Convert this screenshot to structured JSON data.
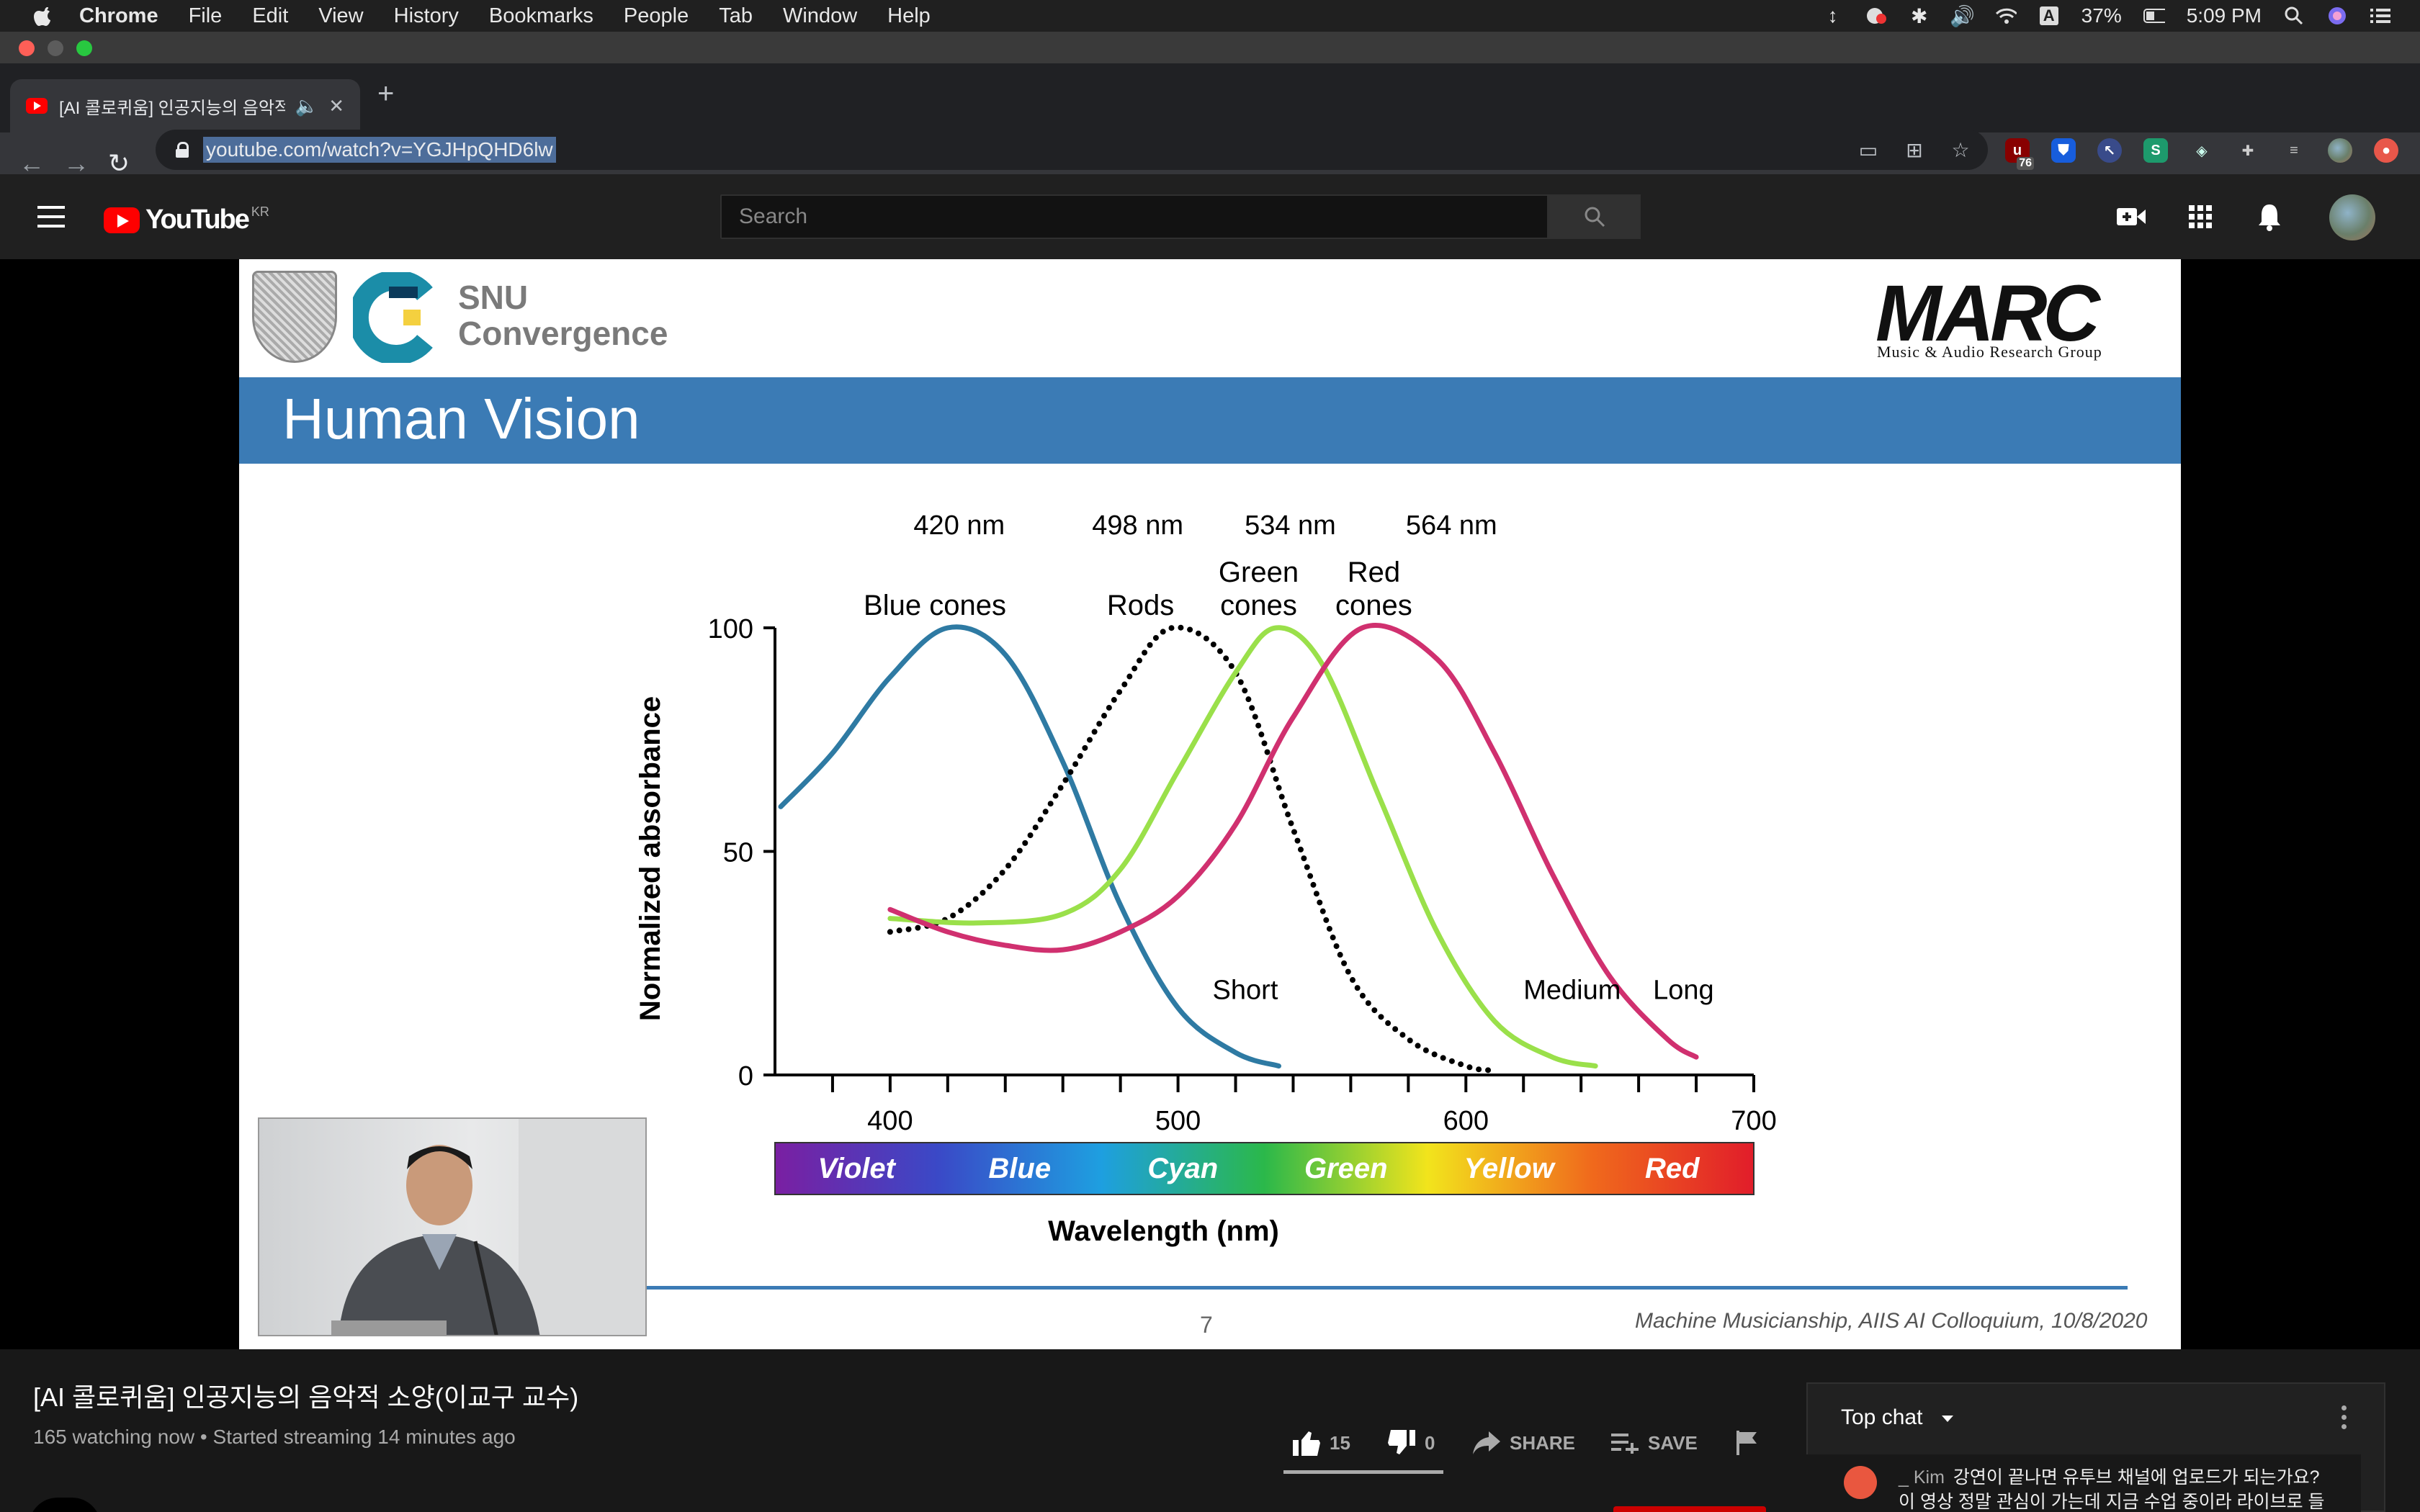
{
  "menubar": {
    "app": "Chrome",
    "items": [
      "File",
      "Edit",
      "View",
      "History",
      "Bookmarks",
      "People",
      "Tab",
      "Window",
      "Help"
    ],
    "battery": "37%",
    "time": "5:09 PM",
    "input_badge": "A"
  },
  "browser": {
    "tab_title": "[AI 콜로퀴움] 인공지능의 음악적",
    "url": "youtube.com/watch?v=YGJHpQHD6lw",
    "ext_badge": "76",
    "ext_s_label": "S"
  },
  "youtube": {
    "logo_text": "YouTube",
    "country": "KR",
    "search_placeholder": "Search"
  },
  "slide": {
    "org_line1": "SNU",
    "org_line2": "Convergence",
    "marc_logo": "MARC",
    "marc_sub": "Music & Audio Research Group",
    "title": "Human Vision",
    "page_number": "7",
    "footer": "Machine Musicianship, AIIS AI Colloquium, 10/8/2020"
  },
  "chart_data": {
    "type": "line",
    "xlabel": "Wavelength (nm)",
    "ylabel": "Normalized absorbance",
    "xlim": [
      360,
      700
    ],
    "ylim": [
      0,
      100
    ],
    "x_ticks": [
      400,
      500,
      600,
      700
    ],
    "y_ticks": [
      0,
      50,
      100
    ],
    "peaks": [
      "420 nm",
      "498 nm",
      "534 nm",
      "564 nm"
    ],
    "series": [
      {
        "name": "Blue cones",
        "end_label": "Short",
        "color": "#2e7aa3",
        "style": "solid",
        "x": [
          362,
          380,
          400,
          420,
          440,
          460,
          480,
          500,
          520,
          535
        ],
        "y": [
          60,
          72,
          89,
          100,
          94,
          70,
          38,
          15,
          5,
          2
        ]
      },
      {
        "name": "Rods",
        "end_label": "",
        "color": "#000000",
        "style": "dotted",
        "x": [
          400,
          420,
          440,
          460,
          480,
          498,
          520,
          540,
          560,
          580,
          600,
          610
        ],
        "y": [
          32,
          35,
          46,
          65,
          86,
          100,
          90,
          55,
          22,
          8,
          2,
          1
        ]
      },
      {
        "name": "Green cones",
        "end_label": "Medium",
        "color": "#9ae04a",
        "style": "solid",
        "x": [
          400,
          430,
          460,
          480,
          500,
          520,
          534,
          550,
          570,
          590,
          610,
          630,
          645
        ],
        "y": [
          35,
          34,
          36,
          46,
          68,
          90,
          100,
          92,
          62,
          32,
          12,
          4,
          2
        ]
      },
      {
        "name": "Red cones",
        "end_label": "Long",
        "color": "#d0306f",
        "style": "solid",
        "x": [
          400,
          420,
          440,
          460,
          480,
          500,
          520,
          540,
          564,
          590,
          610,
          630,
          650,
          670,
          680
        ],
        "y": [
          37,
          32,
          29,
          28,
          32,
          40,
          56,
          80,
          100,
          93,
          72,
          45,
          22,
          8,
          4
        ]
      }
    ],
    "spectrum": {
      "labels": [
        "Violet",
        "Blue",
        "Cyan",
        "Green",
        "Yellow",
        "Red"
      ],
      "colors": [
        "#7a1fa2",
        "#3a49c7",
        "#1e9fe0",
        "#2bb84a",
        "#f2e41c",
        "#f06a1c",
        "#e11d2a"
      ]
    },
    "grid": false,
    "legend": "none"
  },
  "video": {
    "title": "[AI 콜로퀴움] 인공지능의 음악적 소양(이교구 교수)",
    "meta": "165 watching now • Started streaming 14 minutes ago",
    "likes": "15",
    "dislikes": "0",
    "share": "SHARE",
    "save": "SAVE"
  },
  "chat": {
    "header": "Top chat",
    "author": "_ Kim",
    "line1": "강연이 끝나면 유투브 채널에 업로드가 되는가요?",
    "line2": "이 영상 정말 관심이 가는데 지금 수업 중이라 라이브로 들"
  },
  "colors": {
    "youtube_red": "#ff0000",
    "slide_blue": "#3b7bb5",
    "header_bg": "#202020"
  }
}
